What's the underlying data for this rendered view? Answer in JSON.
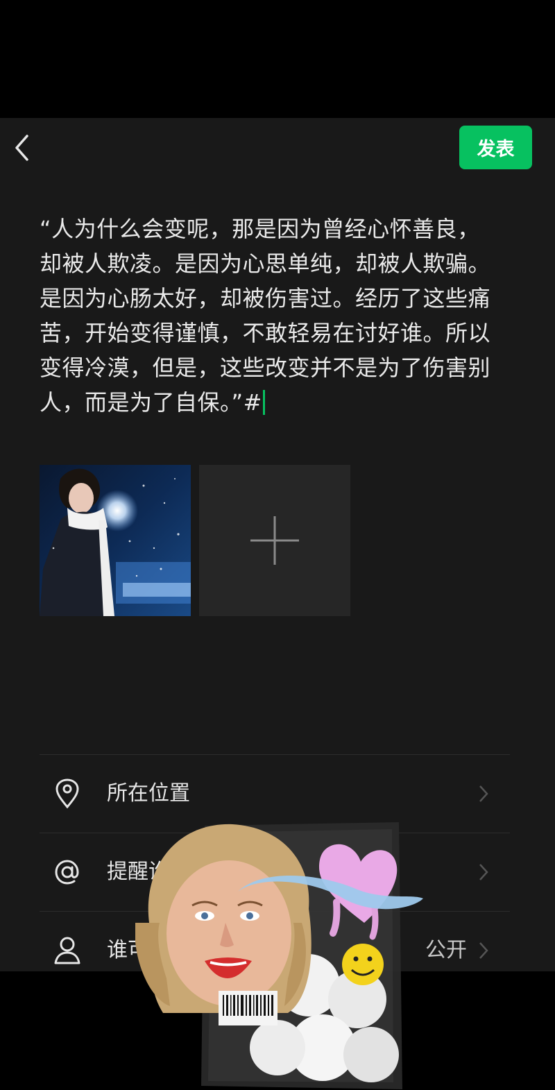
{
  "header": {
    "publish_label": "发表"
  },
  "post": {
    "text": "“人为什么会变呢，那是因为曾经心怀善良，却被人欺凌。是因为心思单纯，却被人欺骗。是因为心肠太好，却被伤害过。经历了这些痛苦，开始变得谨慎，不敢轻易在讨好谁。所以变得冷漠，但是，这些改变并不是为了伤害别人，而是为了自保。”#"
  },
  "options": {
    "location": {
      "label": "所在位置"
    },
    "mention": {
      "label": "提醒谁"
    },
    "visibility": {
      "label": "谁可",
      "value": "公开"
    }
  },
  "colors": {
    "accent": "#07c160",
    "background": "#191919"
  },
  "icons": {
    "back": "chevron-left-icon",
    "location": "location-pin-icon",
    "mention": "at-sign-icon",
    "visibility": "person-icon",
    "add": "plus-icon"
  }
}
